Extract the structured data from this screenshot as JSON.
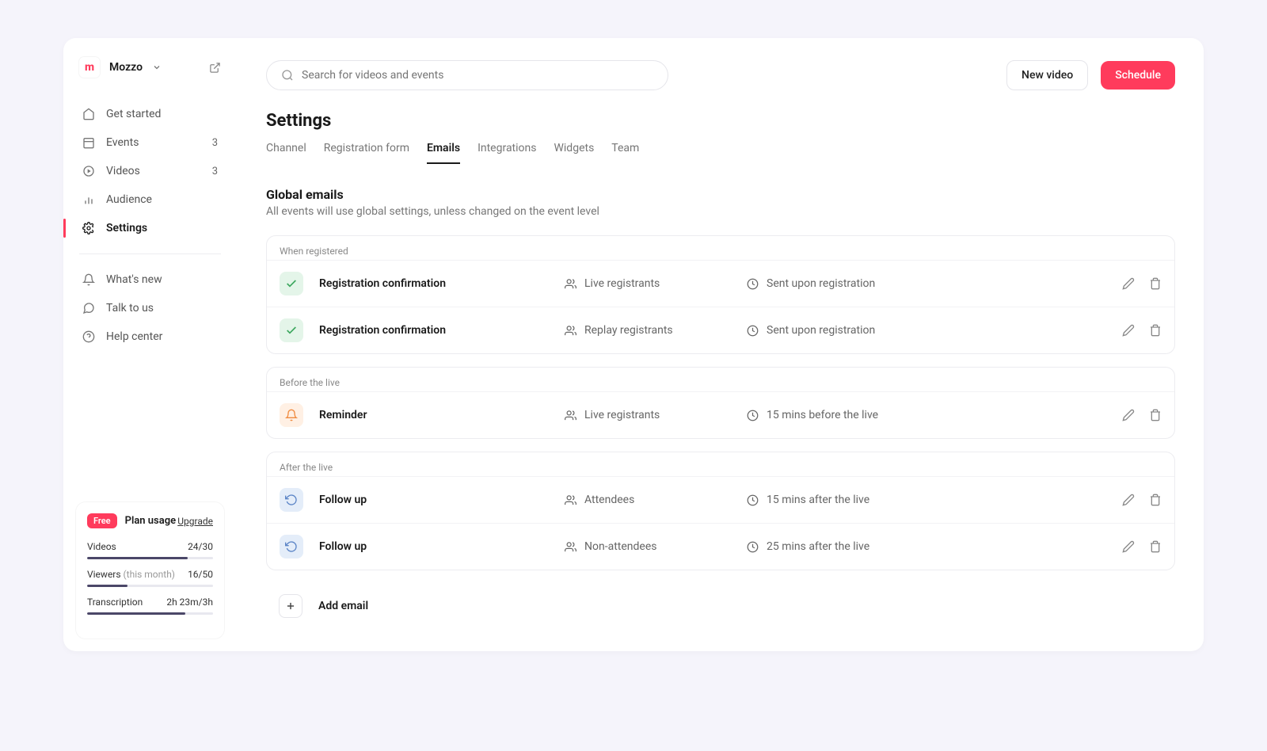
{
  "workspace": {
    "name": "Mozzo"
  },
  "search": {
    "placeholder": "Search for videos and events"
  },
  "topbar": {
    "new_video": "New video",
    "schedule": "Schedule"
  },
  "page": {
    "title": "Settings"
  },
  "tabs": [
    "Channel",
    "Registration form",
    "Emails",
    "Integrations",
    "Widgets",
    "Team"
  ],
  "tabs_active": 2,
  "sidebar": {
    "items": [
      {
        "label": "Get started",
        "count": ""
      },
      {
        "label": "Events",
        "count": "3"
      },
      {
        "label": "Videos",
        "count": "3"
      },
      {
        "label": "Audience",
        "count": ""
      },
      {
        "label": "Settings",
        "count": ""
      }
    ],
    "meta": [
      {
        "label": "What's new"
      },
      {
        "label": "Talk to us"
      },
      {
        "label": "Help center"
      }
    ]
  },
  "plan": {
    "badge": "Free",
    "title": "Plan usage",
    "upgrade": "Upgrade",
    "metrics": [
      {
        "label": "Videos",
        "sub": "",
        "value": "24/30",
        "pct": 80
      },
      {
        "label": "Viewers",
        "sub": "(this month)",
        "value": "16/50",
        "pct": 32
      },
      {
        "label": "Transcription",
        "sub": "",
        "value": "2h 23m/3h",
        "pct": 78
      }
    ]
  },
  "section": {
    "title": "Global emails",
    "desc": "All events will use global settings, unless changed on the event level"
  },
  "groups": [
    {
      "title": "When registered",
      "icon": "check",
      "rows": [
        {
          "name": "Registration confirmation",
          "aud": "Live registrants",
          "time": "Sent upon registration"
        },
        {
          "name": "Registration confirmation",
          "aud": "Replay registrants",
          "time": "Sent upon registration"
        }
      ]
    },
    {
      "title": "Before the live",
      "icon": "bell",
      "rows": [
        {
          "name": "Reminder",
          "aud": "Live registrants",
          "time": "15 mins before the live"
        }
      ]
    },
    {
      "title": "After the live",
      "icon": "replay",
      "rows": [
        {
          "name": "Follow up",
          "aud": "Attendees",
          "time": "15 mins after the live"
        },
        {
          "name": "Follow up",
          "aud": "Non-attendees",
          "time": "25 mins after the live"
        }
      ]
    }
  ],
  "add_email": "Add email"
}
